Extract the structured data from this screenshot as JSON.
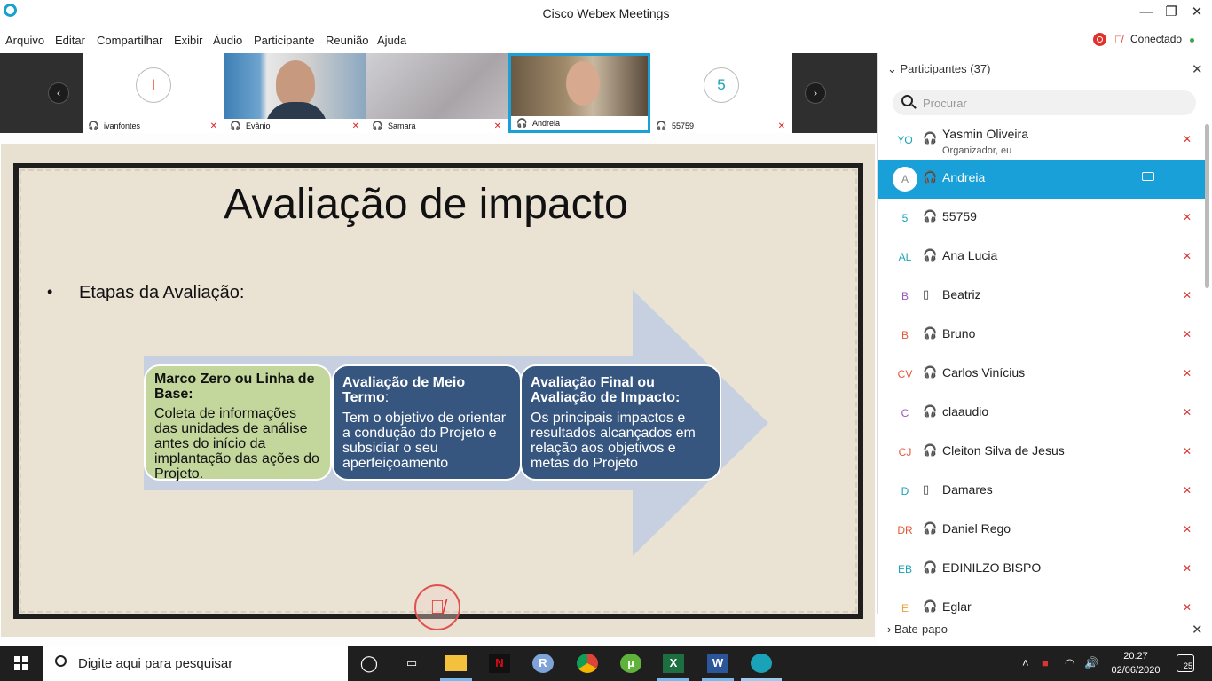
{
  "window": {
    "title": "Cisco Webex Meetings",
    "minimize_icon": "minimize-icon",
    "maximize_icon": "restore-icon",
    "close_icon": "close-icon"
  },
  "menu": [
    "Arquivo",
    "Editar",
    "Compartilhar",
    "Exibir",
    "Áudio",
    "Participante",
    "Reunião",
    "Ajuda"
  ],
  "status": {
    "connection": "Conectado",
    "recording_icon": "record-icon",
    "mute_icon": "mic-muted-icon",
    "colors": {
      "record": "#e0312b",
      "connected": "#3aa652"
    }
  },
  "thumbnails": [
    {
      "name": "ivanfontes",
      "initial": "I",
      "initial_color": "#e25a3a",
      "type": "avatar"
    },
    {
      "name": "Evânio",
      "type": "video"
    },
    {
      "name": "Samara",
      "type": "video-blurred"
    },
    {
      "name": "Andreia",
      "type": "video",
      "active": true
    },
    {
      "name": "55759",
      "initial": "5",
      "initial_color": "#1aa3b8",
      "type": "avatar"
    }
  ],
  "slide": {
    "title": "Avaliação de impacto",
    "bullet_marker": "•",
    "bullet": "Etapas da Avaliação:",
    "boxes": [
      {
        "heading": "Marco Zero ou Linha de Base:",
        "body": "Coleta de informações das unidades de análise antes do início da implantação das ações do Projeto."
      },
      {
        "heading": "Avaliação de Meio Termo",
        "heading_suffix": ":",
        "body": "Tem o objetivo de orientar a condução do Projeto e subsidiar o seu aperfeiçoamento"
      },
      {
        "heading": "Avaliação Final ou Avaliação de Impacto:",
        "body": "Os principais impactos e resultados alcançados em relação aos objetivos e metas do Projeto"
      }
    ],
    "colors": {
      "green_box": "#c3d69b",
      "blue_box": "#36557f",
      "arrow": "#c7d0e0"
    }
  },
  "participants_panel": {
    "title": "Participantes (37)",
    "search_placeholder": "Procurar",
    "chat_label": "Bate-papo",
    "participants": [
      {
        "initials": "YO",
        "name": "Yasmin Oliveira",
        "sub": "Organizador, eu",
        "color": "#1aa3b8",
        "device": "headset-icon",
        "muted": true
      },
      {
        "initials": "A",
        "name": "Andreia",
        "sub": "",
        "color": "#888888",
        "device": "headset-icon",
        "muted": false,
        "active": true,
        "video": true
      },
      {
        "initials": "5",
        "name": "55759",
        "sub": "",
        "color": "#1aa3b8",
        "device": "headset-icon",
        "muted": true
      },
      {
        "initials": "AL",
        "name": "Ana Lucia",
        "sub": "",
        "color": "#1aa3b8",
        "device": "headset-icon",
        "muted": true
      },
      {
        "initials": "B",
        "name": "Beatriz",
        "sub": "",
        "color": "#9b59b6",
        "device": "phone-icon",
        "muted": true
      },
      {
        "initials": "B",
        "name": "Bruno",
        "sub": "",
        "color": "#e25a3a",
        "device": "headset-icon",
        "muted": true
      },
      {
        "initials": "CV",
        "name": "Carlos Vinícius",
        "sub": "",
        "color": "#e25a3a",
        "device": "headset-icon",
        "muted": true
      },
      {
        "initials": "C",
        "name": "claaudio",
        "sub": "",
        "color": "#9b59b6",
        "device": "headset-icon",
        "muted": true
      },
      {
        "initials": "CJ",
        "name": "Cleiton Silva de Jesus",
        "sub": "",
        "color": "#e25a3a",
        "device": "headset-icon",
        "muted": true
      },
      {
        "initials": "D",
        "name": "Damares",
        "sub": "",
        "color": "#1aa3b8",
        "device": "phone-icon",
        "muted": true
      },
      {
        "initials": "DR",
        "name": "Daniel Rego",
        "sub": "",
        "color": "#e25a3a",
        "device": "headset-icon",
        "muted": true
      },
      {
        "initials": "EB",
        "name": "EDINILZO BISPO",
        "sub": "",
        "color": "#1aa3b8",
        "device": "headset-icon",
        "muted": true
      },
      {
        "initials": "E",
        "name": "Eglar",
        "sub": "",
        "color": "#e8a33a",
        "device": "headset-icon",
        "muted": true
      }
    ]
  },
  "taskbar": {
    "search_placeholder": "Digite aqui para pesquisar",
    "apps": [
      "cortana-icon",
      "task-view-icon",
      "file-explorer-icon",
      "netflix-icon",
      "r-icon",
      "chrome-icon",
      "utorrent-icon",
      "excel-icon",
      "word-icon",
      "webex-icon"
    ],
    "time": "20:27",
    "date": "02/06/2020",
    "notification_count": "25"
  }
}
